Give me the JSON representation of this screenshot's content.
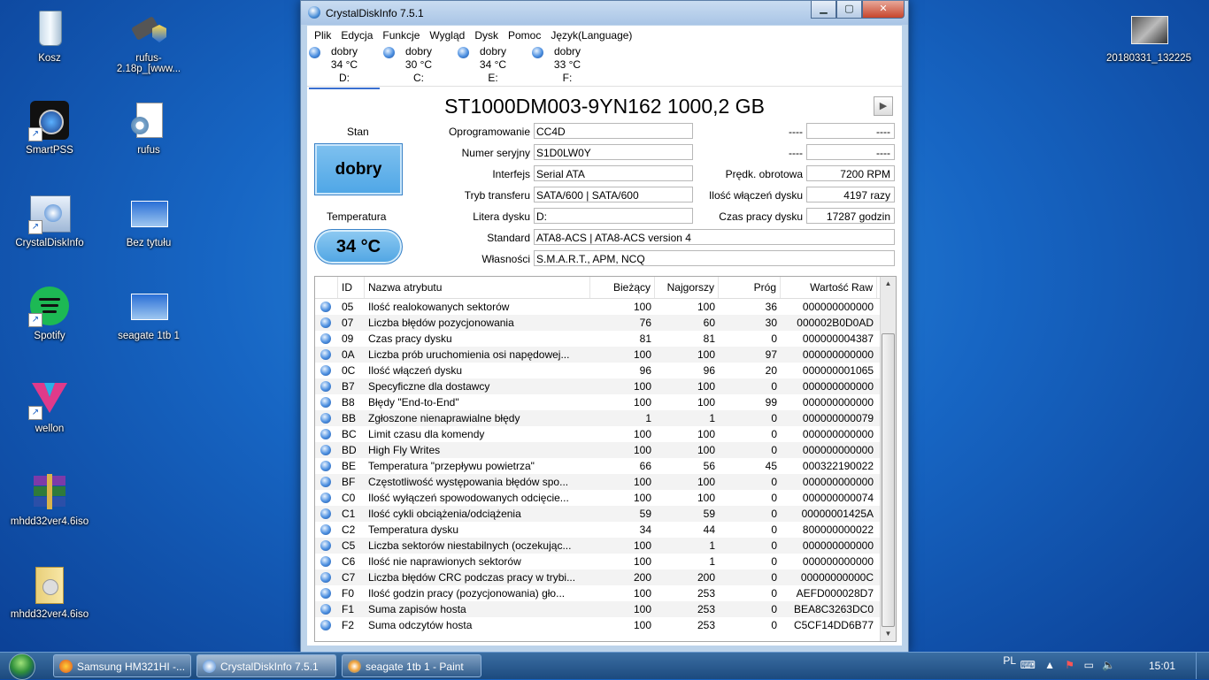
{
  "desktop": {
    "icons_left": [
      {
        "label": "Kosz",
        "icon": "recycle-bin-icon"
      },
      {
        "label": "SmartPSS",
        "icon": "smartpss-icon"
      },
      {
        "label": "CrystalDiskInfo",
        "icon": "crystaldiskinfo-icon"
      },
      {
        "label": "Spotify",
        "icon": "spotify-icon"
      },
      {
        "label": "wellon",
        "icon": "wellon-icon"
      },
      {
        "label": "mhdd32ver4.6iso",
        "icon": "winrar-archive-icon"
      },
      {
        "label": "mhdd32ver4.6iso",
        "icon": "folder-icon"
      }
    ],
    "icons_mid": [
      {
        "label": "rufus-2.18p_[www...",
        "icon": "usb-drive-icon"
      },
      {
        "label": "rufus",
        "icon": "config-file-icon"
      },
      {
        "label": "Bez tytułu",
        "icon": "image-file-icon"
      },
      {
        "label": "seagate 1tb 1",
        "icon": "image-file-icon"
      }
    ],
    "icon_right": {
      "label": "20180331_132225",
      "icon": "photo-thumbnail-icon"
    }
  },
  "window": {
    "title": "CrystalDiskInfo 7.5.1",
    "menu": [
      "Plik",
      "Edycja",
      "Funkcje",
      "Wygląd",
      "Dysk",
      "Pomoc",
      "Język(Language)"
    ],
    "drives": [
      {
        "status": "dobry",
        "temp": "34 °C",
        "letter": "D:"
      },
      {
        "status": "dobry",
        "temp": "30 °C",
        "letter": "C:"
      },
      {
        "status": "dobry",
        "temp": "34 °C",
        "letter": "E:"
      },
      {
        "status": "dobry",
        "temp": "33 °C",
        "letter": "F:"
      }
    ],
    "model": "ST1000DM003-9YN162 1000,2 GB",
    "stan_label": "Stan",
    "stan_value": "dobry",
    "temp_label": "Temperatura",
    "temp_value": "34 °C",
    "fields": {
      "firmware_label": "Oprogramowanie",
      "firmware": "CC4D",
      "serial_label": "Numer seryjny",
      "serial": "S1D0LW0Y",
      "interface_label": "Interfejs",
      "interface": "Serial ATA",
      "transfer_label": "Tryb transferu",
      "transfer": "SATA/600 | SATA/600",
      "letter_label": "Litera dysku",
      "letter": "D:",
      "standard_label": "Standard",
      "standard": "ATA8-ACS | ATA8-ACS version 4",
      "features_label": "Własności",
      "features": "S.M.A.R.T., APM, NCQ",
      "blank1_label": "----",
      "blank1": "----",
      "blank2_label": "----",
      "blank2": "----",
      "rpm_label": "Prędk. obrotowa",
      "rpm": "7200 RPM",
      "powercount_label": "Ilość włączeń dysku",
      "powercount": "4197 razy",
      "hours_label": "Czas pracy dysku",
      "hours": "17287 godzin"
    },
    "table": {
      "headers": [
        "ID",
        "Nazwa atrybutu",
        "Bieżący",
        "Najgorszy",
        "Próg",
        "Wartość Raw"
      ],
      "rows": [
        [
          "05",
          "Ilość realokowanych sektorów",
          "100",
          "100",
          "36",
          "000000000000"
        ],
        [
          "07",
          "Liczba błędów pozycjonowania",
          "76",
          "60",
          "30",
          "000002B0D0AD"
        ],
        [
          "09",
          "Czas pracy dysku",
          "81",
          "81",
          "0",
          "000000004387"
        ],
        [
          "0A",
          "Liczba prób uruchomienia osi napędowej...",
          "100",
          "100",
          "97",
          "000000000000"
        ],
        [
          "0C",
          "Ilość włączeń dysku",
          "96",
          "96",
          "20",
          "000000001065"
        ],
        [
          "B7",
          "Specyficzne dla dostawcy",
          "100",
          "100",
          "0",
          "000000000000"
        ],
        [
          "B8",
          "Błędy \"End-to-End\"",
          "100",
          "100",
          "99",
          "000000000000"
        ],
        [
          "BB",
          "Zgłoszone nienaprawialne błędy",
          "1",
          "1",
          "0",
          "000000000079"
        ],
        [
          "BC",
          "Limit czasu dla komendy",
          "100",
          "100",
          "0",
          "000000000000"
        ],
        [
          "BD",
          "High Fly Writes",
          "100",
          "100",
          "0",
          "000000000000"
        ],
        [
          "BE",
          "Temperatura \"przepływu powietrza\"",
          "66",
          "56",
          "45",
          "000322190022"
        ],
        [
          "BF",
          "Częstotliwość występowania błędów spo...",
          "100",
          "100",
          "0",
          "000000000000"
        ],
        [
          "C0",
          "Ilość wyłączeń spowodowanych odcięcie...",
          "100",
          "100",
          "0",
          "000000000074"
        ],
        [
          "C1",
          "Ilość cykli obciążenia/odciążenia",
          "59",
          "59",
          "0",
          "00000001425A"
        ],
        [
          "C2",
          "Temperatura dysku",
          "34",
          "44",
          "0",
          "800000000022"
        ],
        [
          "C5",
          "Liczba sektorów niestabilnych (oczekując...",
          "100",
          "1",
          "0",
          "000000000000"
        ],
        [
          "C6",
          "Ilość nie naprawionych sektorów",
          "100",
          "1",
          "0",
          "000000000000"
        ],
        [
          "C7",
          "Liczba błędów CRC podczas pracy w trybi...",
          "200",
          "200",
          "0",
          "00000000000C"
        ],
        [
          "F0",
          "Ilość godzin pracy (pozycjonowania) gło...",
          "100",
          "253",
          "0",
          "AEFD000028D7"
        ],
        [
          "F1",
          "Suma zapisów hosta",
          "100",
          "253",
          "0",
          "BEA8C3263DC0"
        ],
        [
          "F2",
          "Suma odczytów hosta",
          "100",
          "253",
          "0",
          "C5CF14DD6B77"
        ]
      ]
    }
  },
  "taskbar": {
    "buttons": [
      "Samsung HM321HI -...",
      "CrystalDiskInfo 7.5.1",
      "seagate 1tb 1 - Paint"
    ],
    "lang": "PL",
    "time": "15:01"
  },
  "colors": {
    "status_good": "#4ea6e6",
    "accent": "#3a6fd0"
  }
}
